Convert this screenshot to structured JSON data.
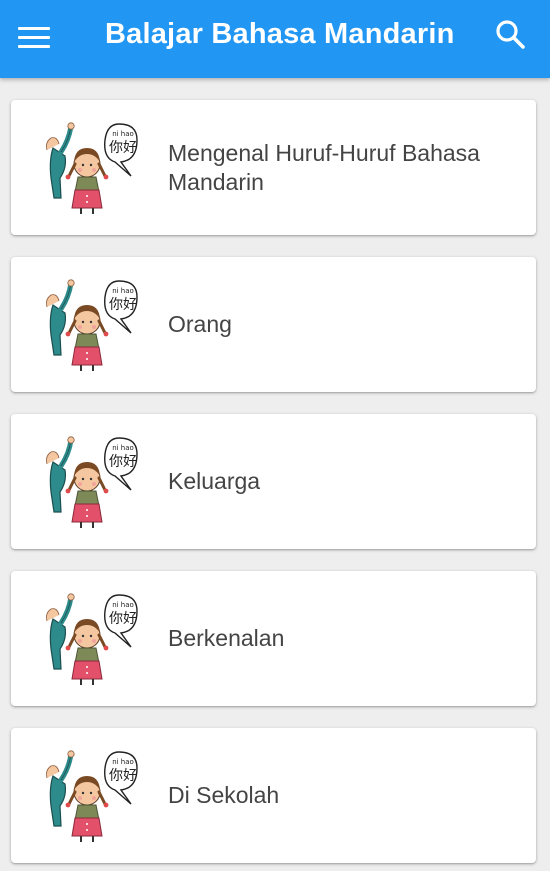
{
  "app_bar": {
    "title": "Balajar Bahasa Mandarin",
    "background_color": "#2196f3",
    "menu_icon": "hamburger-menu-icon",
    "search_icon": "search-icon"
  },
  "lessons": [
    {
      "label": "Mengenal Huruf-Huruf Bahasa Mandarin",
      "image": "nihao-kids-illustration"
    },
    {
      "label": "Orang",
      "image": "nihao-kids-illustration"
    },
    {
      "label": "Keluarga",
      "image": "nihao-kids-illustration"
    },
    {
      "label": "Berkenalan",
      "image": "nihao-kids-illustration"
    },
    {
      "label": "Di Sekolah",
      "image": "nihao-kids-illustration"
    }
  ],
  "illustration": {
    "pinyin": "ni hao",
    "hanzi": "你好"
  }
}
